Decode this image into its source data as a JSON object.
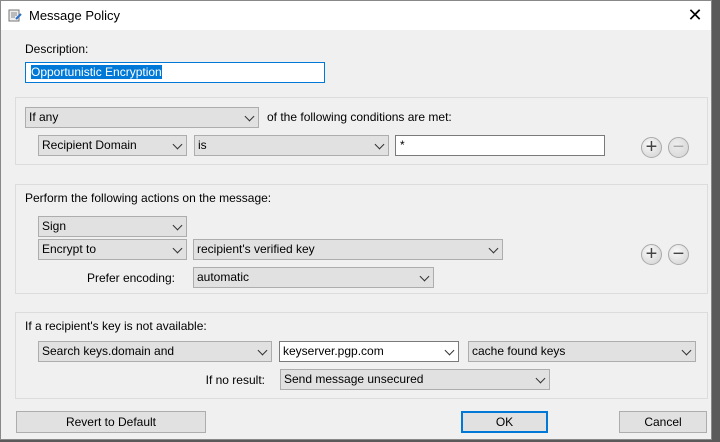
{
  "window": {
    "title": "Message Policy",
    "close_icon": "close-icon"
  },
  "description": {
    "label": "Description:",
    "value": "Opportunistic Encryption"
  },
  "conditions": {
    "match_select": "If any",
    "match_text": "of the following conditions are met:",
    "rows": [
      {
        "field": "Recipient Domain",
        "operator": "is",
        "value": "*"
      }
    ],
    "add_label": "+",
    "remove_label": "−"
  },
  "actions": {
    "heading": "Perform the following actions on the message:",
    "sign": "Sign",
    "encrypt": "Encrypt to",
    "encrypt_target": "recipient's verified key",
    "encoding_label": "Prefer encoding:",
    "encoding": "automatic",
    "add_label": "+",
    "remove_label": "−"
  },
  "fallback": {
    "heading": "If a recipient's key is not available:",
    "search": "Search keys.domain and",
    "server": "keyserver.pgp.com",
    "cache": "cache found keys",
    "no_result_label": "If no result:",
    "no_result": "Send message unsecured"
  },
  "buttons": {
    "revert": "Revert to Default",
    "ok": "OK",
    "cancel": "Cancel"
  }
}
